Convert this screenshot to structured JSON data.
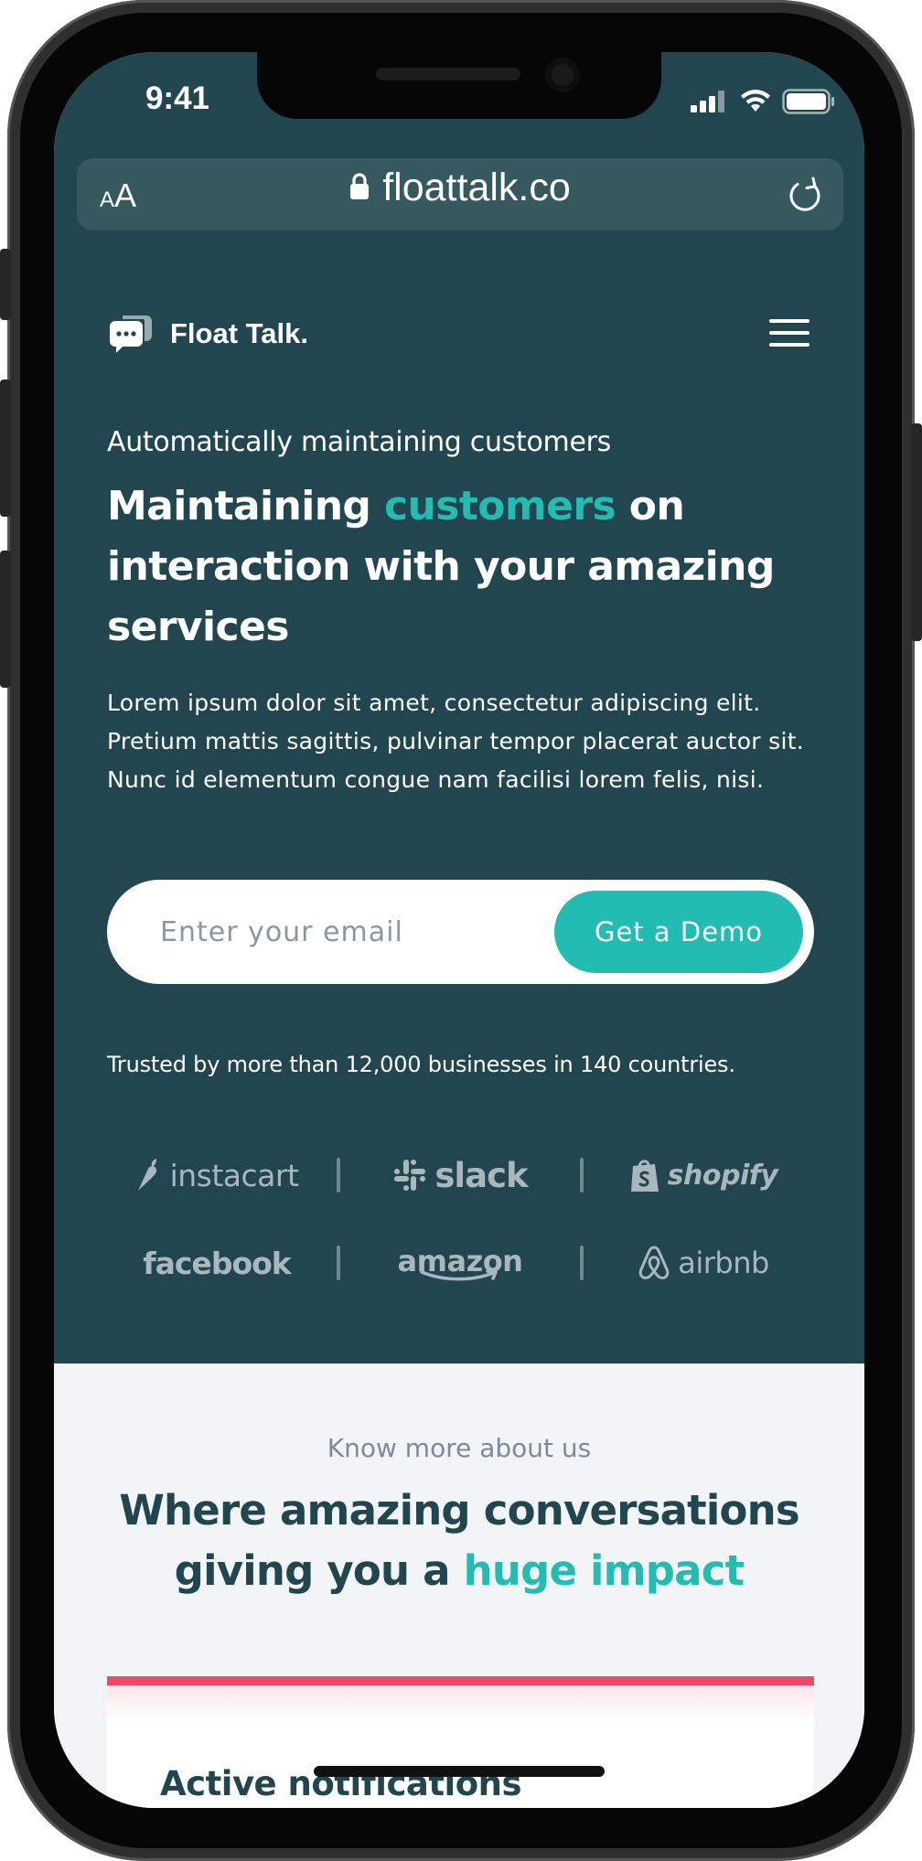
{
  "status_bar": {
    "time": "9:41"
  },
  "browser": {
    "text_size_small": "A",
    "text_size_big": "A",
    "url": "floattalk.co"
  },
  "nav": {
    "brand": "Float Talk."
  },
  "hero": {
    "eyebrow": "Automatically maintaining customers",
    "headline_part1": "Maintaining ",
    "headline_accent": "customers",
    "headline_part2": " on interaction with your amazing services",
    "lead": "Lorem ipsum dolor sit amet, consectetur adipiscing elit. Pretium mattis sagittis, pulvinar tempor placerat auctor sit. Nunc id elementum congue nam facilisi lorem felis, nisi.",
    "email_placeholder": "Enter your email",
    "demo_button": "Get a Demo",
    "trusted": "Trusted by more than 12,000 businesses in 140 countries."
  },
  "logos": {
    "row1": [
      "instacart",
      "slack",
      "shopify"
    ],
    "row2": [
      "facebook",
      "amazon",
      "airbnb"
    ]
  },
  "about": {
    "eyebrow": "Know more about us",
    "title_part1": "Where amazing conversations giving you a ",
    "title_accent": "huge impact",
    "card_title": "Active notifications"
  },
  "colors": {
    "hero_bg": "#21464f",
    "accent": "#22bcb3",
    "card_bar": "#ef4765",
    "section_bg": "#f3f4f6"
  }
}
